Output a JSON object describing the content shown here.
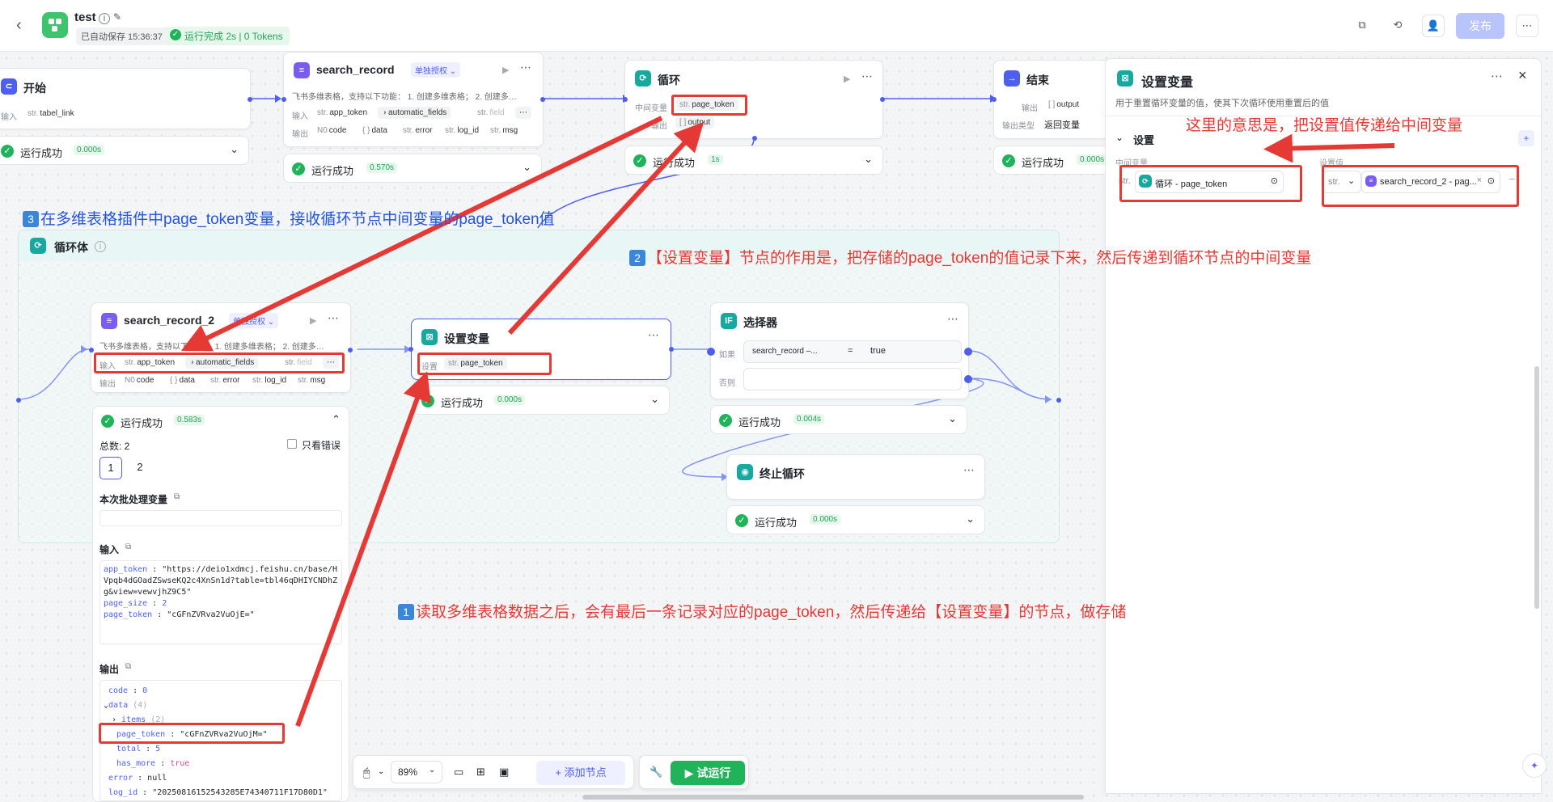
{
  "header": {
    "title": "test",
    "autosave": "已自动保存 15:36:37",
    "run_status": "运行完成 2s | 0 Tokens",
    "publish": "发布"
  },
  "nodes": {
    "start": {
      "title": "开始",
      "input_label": "输入",
      "var_type": "str.",
      "var_name": "tabel_link",
      "status": "运行成功",
      "time": "0.000s"
    },
    "search_record": {
      "title": "search_record",
      "auth": "单独授权",
      "desc": "飞书多维表格，支持以下功能： 1. 创建多维表格； 2. 创建多…",
      "input_label": "输入",
      "output_label": "输出",
      "inputs": [
        "app_token",
        "automatic_fields",
        "field"
      ],
      "input_types": [
        "str.",
        "◑",
        "str."
      ],
      "outputs": [
        "code",
        "data",
        "error",
        "log_id",
        "msg"
      ],
      "output_types": [
        "N0",
        "{ }",
        "str.",
        "str.",
        "str."
      ],
      "status": "运行成功",
      "time": "0.570s"
    },
    "loop": {
      "title": "循环",
      "mid_label": "中间变量",
      "mid_type": "str.",
      "mid_var": "page_token",
      "output_label": "输出",
      "output_type": "[ ]",
      "output_var": "output",
      "status": "运行成功",
      "time": "1s"
    },
    "end": {
      "title": "结束",
      "output_label": "输出",
      "output_type": "[ ]",
      "output_var": "output",
      "output_type_label": "输出类型",
      "output_type_value": "返回变量",
      "status": "运行成功",
      "time": "0.000s"
    },
    "loop_body": {
      "title": "循环体"
    },
    "search_record_2": {
      "title": "search_record_2",
      "auth": "单独授权",
      "desc": "飞书多维表格，支持以下功能： 1. 创建多维表格； 2. 创建多…",
      "input_label": "输入",
      "output_label": "输出",
      "inputs": [
        "app_token",
        "automatic_fields",
        "field"
      ],
      "input_types": [
        "str.",
        "◑",
        "str."
      ],
      "outputs": [
        "code",
        "data",
        "error",
        "log_id",
        "msg"
      ],
      "output_types": [
        "N0",
        "{ }",
        "str.",
        "str.",
        "str."
      ],
      "status": "运行成功",
      "time": "0.583s"
    },
    "set_var": {
      "title": "设置变量",
      "set_label": "设置",
      "var_type": "str.",
      "var_name": "page_token",
      "status": "运行成功",
      "time": "0.000s"
    },
    "selector": {
      "title": "选择器",
      "if_label": "如果",
      "else_label": "否则",
      "cond_left": "search_record –...",
      "cond_op": "=",
      "cond_right": "true",
      "status": "运行成功",
      "time": "0.004s"
    },
    "stop_loop": {
      "title": "终止循环",
      "status": "运行成功",
      "time": "0.000s"
    }
  },
  "result_panel": {
    "total": "总数: 2",
    "only_errors": "只看错误",
    "pages": [
      "1",
      "2"
    ],
    "batch_label": "本次批处理变量",
    "input_label": "输入",
    "input_lines": [
      {
        "key": "app_token",
        "value": "\"https://deio1xdmcj.feishu.cn/base/HVpqb4dGOadZSwseKQ2c4XnSn1d?table=tbl46qDHIYCNDhZg&view=vewvjhZ9C5\""
      },
      {
        "key": "page_size",
        "value": "2"
      },
      {
        "key": "page_token",
        "value": "\"cGFnZVRva2VuOjE=\""
      }
    ],
    "output_label": "输出",
    "output_lines": [
      {
        "key": "code",
        "value": "0"
      },
      {
        "key": "data",
        "value": "(4)"
      },
      {
        "key": "items",
        "value": "(2)"
      },
      {
        "key": "page_token",
        "value": "\"cGFnZVRva2VuOjM=\""
      },
      {
        "key": "total",
        "value": "5"
      },
      {
        "key": "has_more",
        "value": "true"
      },
      {
        "key": "error",
        "value": "null"
      },
      {
        "key": "log_id",
        "value": "\"20250816152543285E74340711F17D80D1\""
      }
    ]
  },
  "side_panel": {
    "title": "设置变量",
    "desc": "用于重置循环变量的值，使其下次循环使用重置后的值",
    "section": "设置",
    "col_mid": "中间变量",
    "col_val": "设置值",
    "mid_type": "str.",
    "mid_value": "循环 - page_token",
    "val_type": "str.",
    "val_value": "search_record_2 - pag..."
  },
  "toolbar": {
    "zoom": "89%",
    "add_node": "添加节点",
    "run": "试运行"
  },
  "annotations": {
    "a1": "读取多维表格数据之后，会有最后一条记录对应的page_token，然后传递给【设置变量】的节点，做存储",
    "a2": "【设置变量】节点的作用是，把存储的page_token的值记录下来，然后传递到循环节点的中间变量",
    "a3": "在多维表格插件中page_token变量，接收循环节点中间变量的page_token值",
    "a4": "这里的意思是，把设置值传递给中间变量",
    "n1": "1",
    "n2": "2",
    "n3": "3"
  },
  "colors": {
    "accent": "#4e5ff0",
    "success": "#21b35a",
    "annotation_red": "#e53935",
    "annotation_blue": "#2255e0"
  }
}
